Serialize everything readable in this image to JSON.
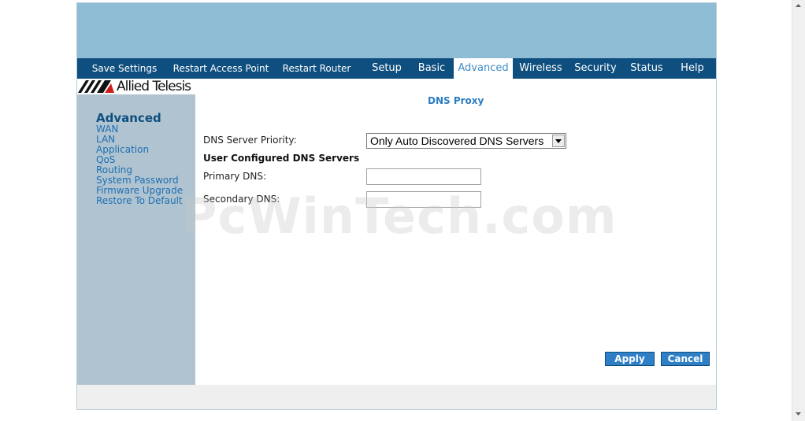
{
  "nav": {
    "items": [
      {
        "label": "Save Settings",
        "active": false
      },
      {
        "label": "Restart Access Point",
        "active": false
      },
      {
        "label": "Restart Router",
        "active": false
      },
      {
        "label": "Setup",
        "active": false
      },
      {
        "label": "Basic",
        "active": false
      },
      {
        "label": "Advanced",
        "active": true
      },
      {
        "label": "Wireless",
        "active": false
      },
      {
        "label": "Security",
        "active": false
      },
      {
        "label": "Status",
        "active": false
      },
      {
        "label": "Help",
        "active": false
      }
    ]
  },
  "logo": {
    "text": "Allied Telesis",
    "icon": "allied-telesis-logo-icon"
  },
  "sidebar": {
    "title": "Advanced",
    "items": [
      {
        "label": "WAN"
      },
      {
        "label": "LAN"
      },
      {
        "label": "Application"
      },
      {
        "label": "QoS"
      },
      {
        "label": "Routing"
      },
      {
        "label": "System Password"
      },
      {
        "label": "Firmware Upgrade"
      },
      {
        "label": "Restore To Default"
      }
    ]
  },
  "main": {
    "title": "DNS Proxy",
    "priority_label": "DNS Server Priority:",
    "priority_value": "Only Auto Discovered DNS Servers",
    "section_label": "User Configured DNS Servers",
    "primary_label": "Primary DNS:",
    "primary_value": "",
    "secondary_label": "Secondary DNS:",
    "secondary_value": "",
    "apply_label": "Apply",
    "cancel_label": "Cancel"
  },
  "watermark": "PcWinTech.com",
  "colors": {
    "banner": "#8dbcd4",
    "nav_bar": "#0f4f7f",
    "active_tab_text": "#3d8cc7",
    "sidebar_bg": "#b0c3d0",
    "link": "#1e6fb3",
    "button": "#2f7fc6"
  }
}
